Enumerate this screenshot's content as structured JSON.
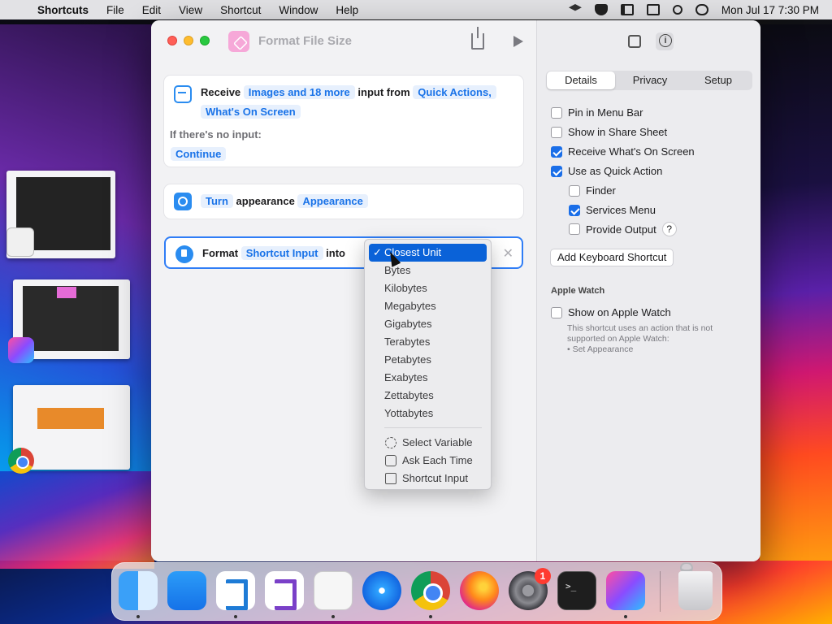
{
  "menubar": {
    "app": "Shortcuts",
    "items": [
      "File",
      "Edit",
      "View",
      "Shortcut",
      "Window",
      "Help"
    ],
    "clock": "Mon Jul 17  7:30 PM"
  },
  "window": {
    "title": "Format File Size",
    "card1": {
      "receive": "Receive",
      "types_chip": "Images and 18 more",
      "input_from": "input from",
      "sources_chip_1": "Quick Actions,",
      "sources_chip_2": "What's On Screen",
      "no_input_label": "If there's no input:",
      "no_input_action": "Continue"
    },
    "card2": {
      "turn_chip": "Turn",
      "appearance_text": "appearance",
      "appearance_chip": "Appearance"
    },
    "card3": {
      "format": "Format",
      "input_chip": "Shortcut Input",
      "into": "into"
    },
    "dropdown": {
      "selected": "Closest Unit",
      "units": [
        "Bytes",
        "Kilobytes",
        "Megabytes",
        "Gigabytes",
        "Terabytes",
        "Petabytes",
        "Exabytes",
        "Zettabytes",
        "Yottabytes"
      ],
      "extras": [
        "Select Variable",
        "Ask Each Time",
        "Shortcut Input"
      ]
    }
  },
  "details": {
    "tabs": [
      "Details",
      "Privacy",
      "Setup"
    ],
    "options": {
      "pin": "Pin in Menu Bar",
      "share": "Show in Share Sheet",
      "receive_screen": "Receive What's On Screen",
      "quick_action": "Use as Quick Action",
      "finder": "Finder",
      "services": "Services Menu",
      "provide_output": "Provide Output"
    },
    "help_glyph": "?",
    "keyboard_button": "Add Keyboard Shortcut",
    "apple_watch": {
      "heading": "Apple Watch",
      "show": "Show on Apple Watch",
      "note_1": "This shortcut uses an action that is not",
      "note_2": "supported on Apple Watch:",
      "note_3": "• Set Appearance"
    }
  },
  "dock": {
    "settings_badge": "1",
    "terminal_prompt": ">_"
  },
  "colors": {
    "accent": "#1a73e8",
    "selection": "#0a62d8",
    "checkbox_on": "#1a6ee8"
  }
}
